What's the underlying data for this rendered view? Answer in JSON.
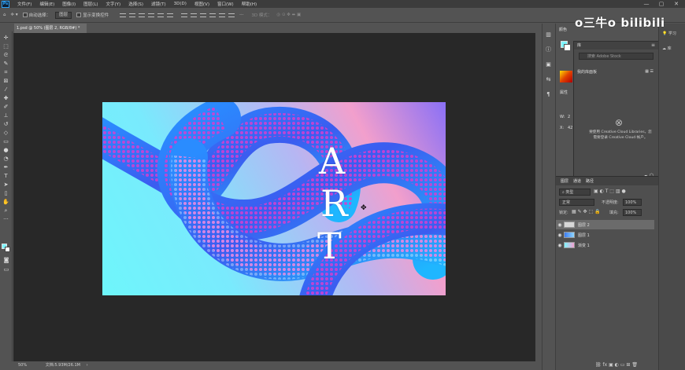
{
  "app": {
    "logo": "Ps"
  },
  "menu": [
    "文件(F)",
    "编辑(E)",
    "图像(I)",
    "图层(L)",
    "文字(Y)",
    "选择(S)",
    "滤镜(T)",
    "3D(D)",
    "视图(V)",
    "窗口(W)",
    "帮助(H)"
  ],
  "window_controls": {
    "minimize": "—",
    "maximize": "▢",
    "close": "✕"
  },
  "options_bar": {
    "auto_select_label": "自动选择：",
    "auto_select_value": "图层",
    "show_transform_label": "显示变换控件",
    "mode_3d_label": "3D 模式："
  },
  "document": {
    "tab_title": "1.psd @ 50% (图层 2, RGB/8#) *",
    "zoom": "50%",
    "doc_size": "文档:5.93M/26.1M"
  },
  "artwork": {
    "letters": [
      "A",
      "R",
      "T"
    ]
  },
  "watermark": "o三牛o bilibili",
  "far_right": {
    "learn_label": "学习",
    "library_label": "库"
  },
  "panels": {
    "color_tab": "颜色",
    "library_tab": "库",
    "library_search_placeholder": "搜索 Adobe Stock",
    "library_name": "我的库面板",
    "properties_tab": "属性",
    "w_label": "W:",
    "x_label": "X:",
    "w_value": "2",
    "x_value": "42",
    "cc_message_line1": "要使用 Creative Cloud Libraries，您",
    "cc_message_line2": "需要登录 Creative Cloud 帐户。",
    "layers_tabs": [
      "图层",
      "通道",
      "路径"
    ],
    "layer_filter": "类型",
    "blend_mode": "正常",
    "opacity_label": "不透明度:",
    "opacity_value": "100%",
    "lock_label": "锁定:",
    "fill_label": "填充:",
    "fill_value": "100%",
    "layers": [
      {
        "name": "图层 2",
        "thumb": "#d8d8d8",
        "selected": true
      },
      {
        "name": "图层 1",
        "thumb": "#4aa6f0",
        "selected": false
      },
      {
        "name": "渐变 1",
        "thumb": "#9fd8f0",
        "selected": false
      }
    ]
  }
}
